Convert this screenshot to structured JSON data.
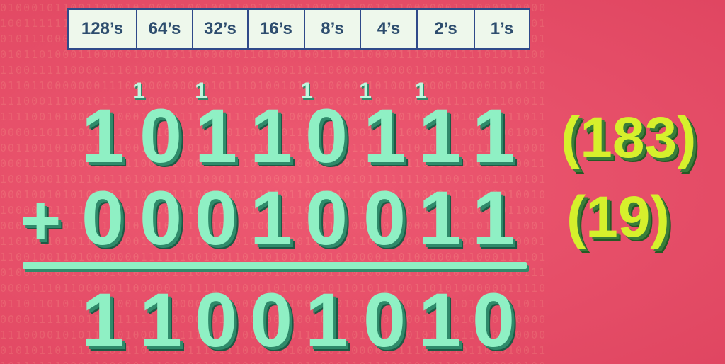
{
  "place_values": [
    "128’s",
    "64’s",
    "32’s",
    "16’s",
    "8’s",
    "4’s",
    "2’s",
    "1’s"
  ],
  "carries": [
    "1",
    "1",
    "1",
    "1",
    "1"
  ],
  "top_number_digits": [
    "1",
    "0",
    "1",
    "1",
    "0",
    "1",
    "1",
    "1"
  ],
  "plus_sign": "+",
  "addend_digits": [
    "0",
    "0",
    "0",
    "1",
    "0",
    "0",
    "1",
    "1"
  ],
  "result_digits": [
    "1",
    "1",
    "0",
    "0",
    "1",
    "0",
    "1",
    "0"
  ],
  "top_decimal": "(183)",
  "addend_decimal": "(19)",
  "colors": {
    "background": "#e8506a",
    "digit": "#8ff0c4",
    "digit_shadow": "#2f8a6a",
    "decimal": "#d6f02c",
    "header_bg": "#eef8ec",
    "header_border": "#2f4a8a",
    "header_text": "#2d4d6e"
  }
}
